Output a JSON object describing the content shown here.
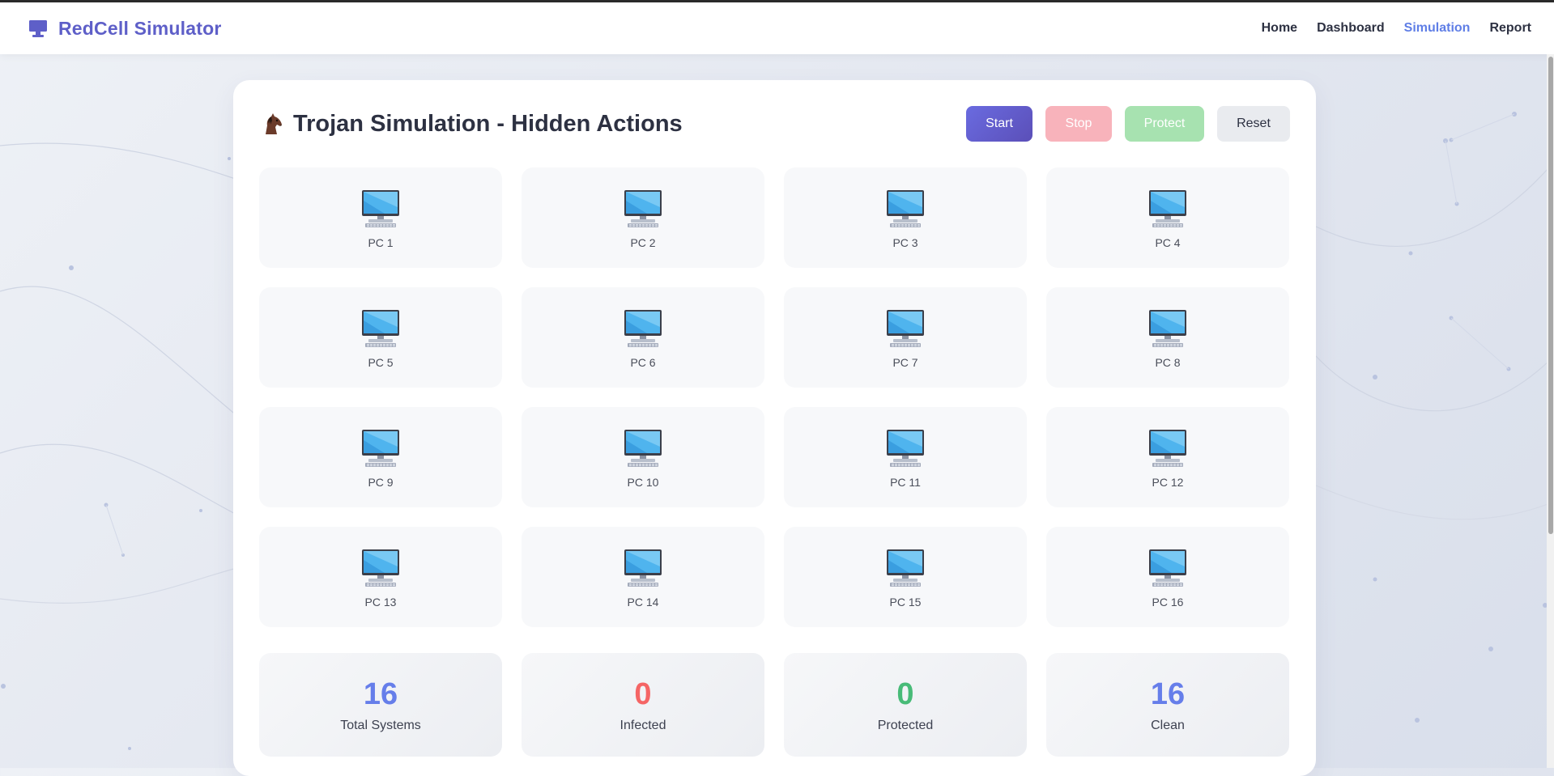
{
  "app": {
    "name": "RedCell Simulator"
  },
  "nav": {
    "items": [
      {
        "label": "Home",
        "active": false
      },
      {
        "label": "Dashboard",
        "active": false
      },
      {
        "label": "Simulation",
        "active": true
      },
      {
        "label": "Report",
        "active": false
      }
    ]
  },
  "simulation": {
    "title": "Trojan Simulation - Hidden Actions",
    "title_icon": "horse-icon",
    "buttons": {
      "start": "Start",
      "stop": "Stop",
      "protect": "Protect",
      "reset": "Reset"
    },
    "pcs": [
      "PC 1",
      "PC 2",
      "PC 3",
      "PC 4",
      "PC 5",
      "PC 6",
      "PC 7",
      "PC 8",
      "PC 9",
      "PC 10",
      "PC 11",
      "PC 12",
      "PC 13",
      "PC 14",
      "PC 15",
      "PC 16"
    ],
    "pc_icon": "desktop-computer-icon"
  },
  "stats": [
    {
      "value": "16",
      "label": "Total Systems",
      "color": "#667eea"
    },
    {
      "value": "0",
      "label": "Infected",
      "color": "#f56565"
    },
    {
      "value": "0",
      "label": "Protected",
      "color": "#48bb78"
    },
    {
      "value": "16",
      "label": "Clean",
      "color": "#667eea"
    }
  ],
  "colors": {
    "brand": "#5e5fc8",
    "nav_active": "#5f7ee6",
    "start": "#5b4fb8",
    "stop": "#f8b3bb",
    "protect": "#a7e2b0"
  }
}
